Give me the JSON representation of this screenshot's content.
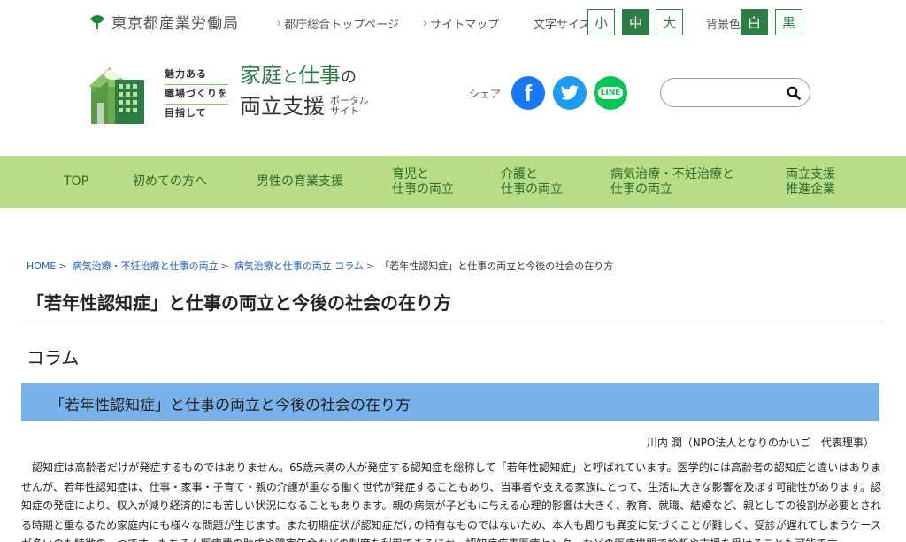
{
  "header": {
    "bureau_name": "東京都産業労働局",
    "links": [
      {
        "label": "都庁総合トップページ"
      },
      {
        "label": "サイトマップ"
      }
    ],
    "font_size_label": "文字サイズ",
    "font_size_options": [
      "小",
      "中",
      "大"
    ],
    "font_size_selected": "中",
    "background_label": "背景色",
    "background_options": [
      "白",
      "黒"
    ],
    "background_selected": "白"
  },
  "logo": {
    "tagline": [
      "魅力ある",
      "職場づくりを",
      "目指して"
    ],
    "title_part1": "家庭",
    "title_to": "と",
    "title_part2": "仕事",
    "title_no": "の",
    "title_line2": "両立支援",
    "portal_line1": "ポータル",
    "portal_line2": "サイト"
  },
  "share": {
    "label": "シェア",
    "facebook_glyph": "f",
    "line_glyph": "LINE"
  },
  "search": {
    "placeholder": "",
    "value": ""
  },
  "nav": [
    {
      "line1": "TOP",
      "line2": ""
    },
    {
      "line1": "初めての方へ",
      "line2": ""
    },
    {
      "line1": "男性の育業支援",
      "line2": ""
    },
    {
      "line1": "育児と",
      "line2": "仕事の両立"
    },
    {
      "line1": "介護と",
      "line2": "仕事の両立"
    },
    {
      "line1": "病気治療・不妊治療と",
      "line2": "仕事の両立"
    },
    {
      "line1": "両立支援",
      "line2": "推進企業"
    }
  ],
  "breadcrumb": [
    {
      "label": "HOME"
    },
    {
      "label": "病気治療・不妊治療と仕事の両立"
    },
    {
      "label": "病気治療と仕事の両立 コラム"
    },
    {
      "label": "「若年性認知症」と仕事の両立と今後の社会の在り方"
    }
  ],
  "page_title": "「若年性認知症」と仕事の両立と今後の社会の在り方",
  "section_label": "コラム",
  "article": {
    "heading": "「若年性認知症」と仕事の両立と今後の社会の在り方",
    "author": "川内 潤（NPO法人となりのかいご　代表理事）",
    "body": "認知症は高齢者だけが発症するものではありません。65歳未満の人が発症する認知症を総称して「若年性認知症」と呼ばれています。医学的には高齢者の認知症と違いはありませんが、若年性認知症は、仕事・家事・子育て・親の介護が重なる働く世代が発症することもあり、当事者や支える家族にとって、生活に大きな影響を及ぼす可能性があります。認知症の発症により、収入が減り経済的にも苦しい状況になることもあります。親の病気が子どもに与える心理的影響は大きく、教育、就職、結婚など、親としての役割が必要とされる時期と重なるため家庭内にも様々な問題が生じます。また初期症状が認知症だけの特有なものではないため、本人も周りも異変に気づくことが難しく、受診が遅れてしまうケースが多いのも特徴の一つです。もちろん医療費の助成や障害年金などの制度を利用できるほか、認知症疾患医療センターなどの医療機関で診断や支援を受けることも可能です。"
  },
  "colors": {
    "brand_green": "#2e7d46",
    "nav_green": "#b8dd86",
    "heading_blue": "#77b2ea",
    "link_blue": "#1a5fb4"
  }
}
